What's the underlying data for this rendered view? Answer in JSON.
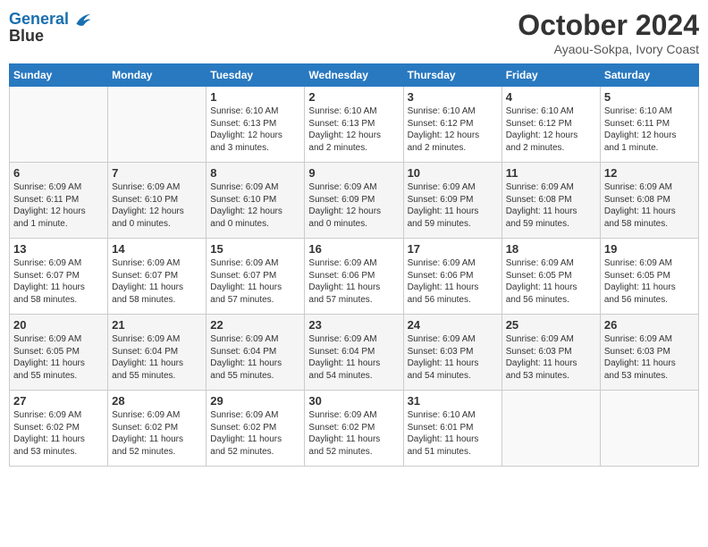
{
  "header": {
    "logo_line1": "General",
    "logo_line2": "Blue",
    "month_title": "October 2024",
    "location": "Ayaou-Sokpa, Ivory Coast"
  },
  "columns": [
    "Sunday",
    "Monday",
    "Tuesday",
    "Wednesday",
    "Thursday",
    "Friday",
    "Saturday"
  ],
  "weeks": [
    [
      {
        "day": "",
        "info": ""
      },
      {
        "day": "",
        "info": ""
      },
      {
        "day": "1",
        "info": "Sunrise: 6:10 AM\nSunset: 6:13 PM\nDaylight: 12 hours\nand 3 minutes."
      },
      {
        "day": "2",
        "info": "Sunrise: 6:10 AM\nSunset: 6:13 PM\nDaylight: 12 hours\nand 2 minutes."
      },
      {
        "day": "3",
        "info": "Sunrise: 6:10 AM\nSunset: 6:12 PM\nDaylight: 12 hours\nand 2 minutes."
      },
      {
        "day": "4",
        "info": "Sunrise: 6:10 AM\nSunset: 6:12 PM\nDaylight: 12 hours\nand 2 minutes."
      },
      {
        "day": "5",
        "info": "Sunrise: 6:10 AM\nSunset: 6:11 PM\nDaylight: 12 hours\nand 1 minute."
      }
    ],
    [
      {
        "day": "6",
        "info": "Sunrise: 6:09 AM\nSunset: 6:11 PM\nDaylight: 12 hours\nand 1 minute."
      },
      {
        "day": "7",
        "info": "Sunrise: 6:09 AM\nSunset: 6:10 PM\nDaylight: 12 hours\nand 0 minutes."
      },
      {
        "day": "8",
        "info": "Sunrise: 6:09 AM\nSunset: 6:10 PM\nDaylight: 12 hours\nand 0 minutes."
      },
      {
        "day": "9",
        "info": "Sunrise: 6:09 AM\nSunset: 6:09 PM\nDaylight: 12 hours\nand 0 minutes."
      },
      {
        "day": "10",
        "info": "Sunrise: 6:09 AM\nSunset: 6:09 PM\nDaylight: 11 hours\nand 59 minutes."
      },
      {
        "day": "11",
        "info": "Sunrise: 6:09 AM\nSunset: 6:08 PM\nDaylight: 11 hours\nand 59 minutes."
      },
      {
        "day": "12",
        "info": "Sunrise: 6:09 AM\nSunset: 6:08 PM\nDaylight: 11 hours\nand 58 minutes."
      }
    ],
    [
      {
        "day": "13",
        "info": "Sunrise: 6:09 AM\nSunset: 6:07 PM\nDaylight: 11 hours\nand 58 minutes."
      },
      {
        "day": "14",
        "info": "Sunrise: 6:09 AM\nSunset: 6:07 PM\nDaylight: 11 hours\nand 58 minutes."
      },
      {
        "day": "15",
        "info": "Sunrise: 6:09 AM\nSunset: 6:07 PM\nDaylight: 11 hours\nand 57 minutes."
      },
      {
        "day": "16",
        "info": "Sunrise: 6:09 AM\nSunset: 6:06 PM\nDaylight: 11 hours\nand 57 minutes."
      },
      {
        "day": "17",
        "info": "Sunrise: 6:09 AM\nSunset: 6:06 PM\nDaylight: 11 hours\nand 56 minutes."
      },
      {
        "day": "18",
        "info": "Sunrise: 6:09 AM\nSunset: 6:05 PM\nDaylight: 11 hours\nand 56 minutes."
      },
      {
        "day": "19",
        "info": "Sunrise: 6:09 AM\nSunset: 6:05 PM\nDaylight: 11 hours\nand 56 minutes."
      }
    ],
    [
      {
        "day": "20",
        "info": "Sunrise: 6:09 AM\nSunset: 6:05 PM\nDaylight: 11 hours\nand 55 minutes."
      },
      {
        "day": "21",
        "info": "Sunrise: 6:09 AM\nSunset: 6:04 PM\nDaylight: 11 hours\nand 55 minutes."
      },
      {
        "day": "22",
        "info": "Sunrise: 6:09 AM\nSunset: 6:04 PM\nDaylight: 11 hours\nand 55 minutes."
      },
      {
        "day": "23",
        "info": "Sunrise: 6:09 AM\nSunset: 6:04 PM\nDaylight: 11 hours\nand 54 minutes."
      },
      {
        "day": "24",
        "info": "Sunrise: 6:09 AM\nSunset: 6:03 PM\nDaylight: 11 hours\nand 54 minutes."
      },
      {
        "day": "25",
        "info": "Sunrise: 6:09 AM\nSunset: 6:03 PM\nDaylight: 11 hours\nand 53 minutes."
      },
      {
        "day": "26",
        "info": "Sunrise: 6:09 AM\nSunset: 6:03 PM\nDaylight: 11 hours\nand 53 minutes."
      }
    ],
    [
      {
        "day": "27",
        "info": "Sunrise: 6:09 AM\nSunset: 6:02 PM\nDaylight: 11 hours\nand 53 minutes."
      },
      {
        "day": "28",
        "info": "Sunrise: 6:09 AM\nSunset: 6:02 PM\nDaylight: 11 hours\nand 52 minutes."
      },
      {
        "day": "29",
        "info": "Sunrise: 6:09 AM\nSunset: 6:02 PM\nDaylight: 11 hours\nand 52 minutes."
      },
      {
        "day": "30",
        "info": "Sunrise: 6:09 AM\nSunset: 6:02 PM\nDaylight: 11 hours\nand 52 minutes."
      },
      {
        "day": "31",
        "info": "Sunrise: 6:10 AM\nSunset: 6:01 PM\nDaylight: 11 hours\nand 51 minutes."
      },
      {
        "day": "",
        "info": ""
      },
      {
        "day": "",
        "info": ""
      }
    ]
  ]
}
